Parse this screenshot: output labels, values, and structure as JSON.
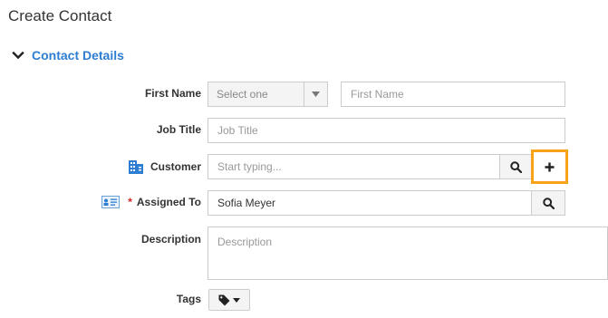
{
  "page": {
    "title": "Create Contact"
  },
  "section": {
    "title": "Contact Details",
    "toggle_icon": "chevron-down-icon"
  },
  "fields": {
    "first_name": {
      "label": "First Name",
      "salutation_placeholder": "Select one",
      "placeholder": "First Name"
    },
    "job_title": {
      "label": "Job Title",
      "placeholder": "Job Title"
    },
    "customer": {
      "label": "Customer",
      "icon": "building-icon",
      "placeholder": "Start typing...",
      "search_icon": "search-icon",
      "add_icon": "plus-icon"
    },
    "assigned_to": {
      "label": "Assigned To",
      "icon": "contact-card-icon",
      "required_mark": "*",
      "value": "Sofia Meyer",
      "search_icon": "search-icon"
    },
    "description": {
      "label": "Description",
      "placeholder": "Description"
    },
    "tags": {
      "label": "Tags",
      "icon": "tag-icon"
    }
  },
  "colors": {
    "accent": "#2d7dd2",
    "highlight": "#f7a21b",
    "required": "#dd2222"
  }
}
